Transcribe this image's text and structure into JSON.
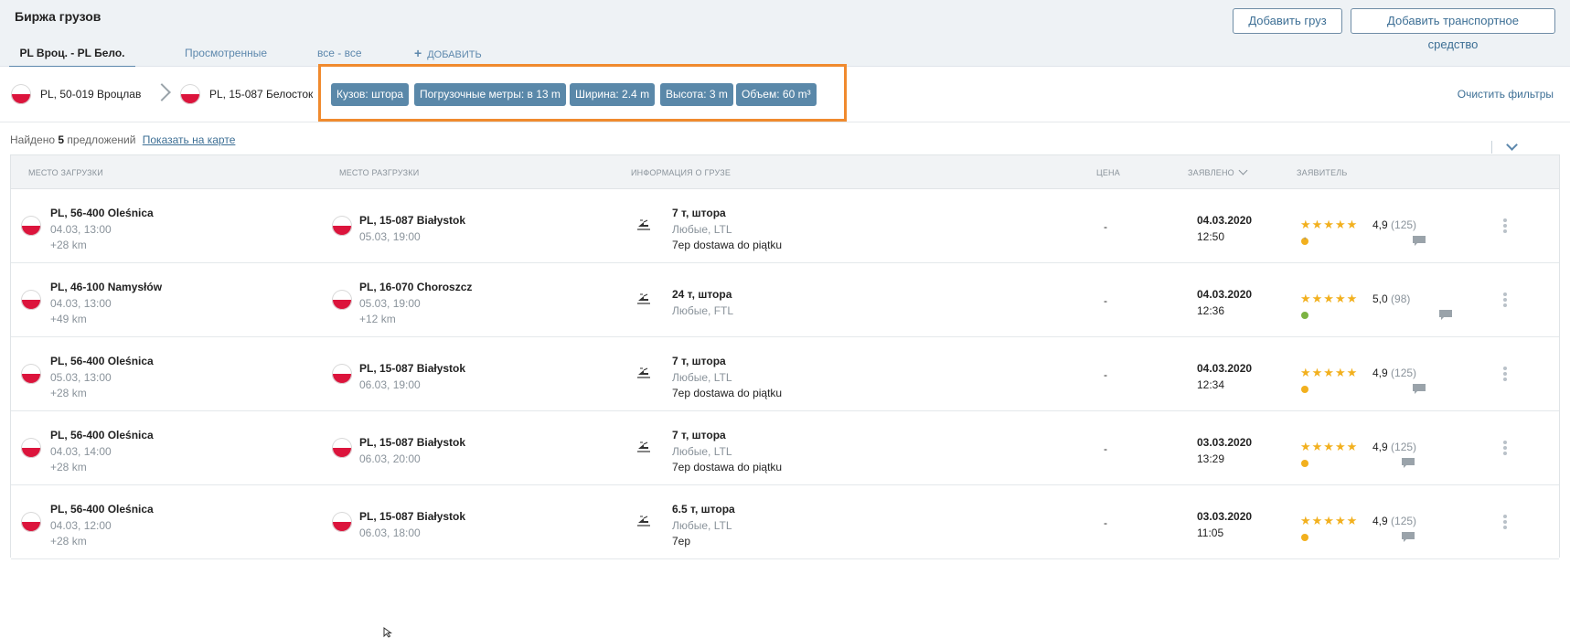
{
  "header": {
    "title": "Биржа грузов",
    "add_cargo": "Добавить груз",
    "add_vehicle": "Добавить транспортное средство"
  },
  "tabs": [
    {
      "label": "PL Вроц. - PL Бело."
    },
    {
      "label": "Просмотренные"
    },
    {
      "label": "все - все"
    },
    {
      "label": "ДОБАВИТЬ",
      "icon": "plus"
    }
  ],
  "filters": {
    "origin": "PL, 50-019 Вроцлав",
    "destination": "PL, 15-087 Белосток",
    "chips": [
      "Кузов: штора",
      "Погрузочные метры: в 13 m",
      "Ширина: 2.4 m",
      "Высота: 3 m",
      "Объем: 60 m³"
    ],
    "clear": "Очистить фильтры"
  },
  "results": {
    "prefix": "Найдено",
    "count": "5",
    "suffix": "предложений",
    "map_link": "Показать на карте"
  },
  "columns": {
    "load": "МЕСТО ЗАГРУЗКИ",
    "unload": "МЕСТО РАЗГРУЗКИ",
    "cargo": "ИНФОРМАЦИЯ О ГРУЗЕ",
    "price": "ЦЕНА",
    "declared": "ЗАЯВЛЕНО",
    "company": "ЗАЯВИТЕЛЬ"
  },
  "rows": [
    {
      "load_place": "PL, 56-400 Oleśnica",
      "load_time": "04.03, 13:00",
      "load_dist": "+28 km",
      "unload_place": "PL, 15-087 Białystok",
      "unload_time": "05.03, 19:00",
      "unload_dist": "",
      "cargo_title": "7 т, штора",
      "cargo_type": "Любые, LTL",
      "cargo_note": "7ep dostawa do piątku",
      "price": "-",
      "date": "04.03.2020",
      "time": "12:50",
      "stars": "★★★★★",
      "rating": "4,9",
      "reviews": "(125)",
      "status_color": "#f2b01e",
      "extra": "'"
    },
    {
      "load_place": "PL, 46-100 Namysłów",
      "load_time": "04.03, 13:00",
      "load_dist": "+49 km",
      "unload_place": "PL, 16-070 Choroszcz",
      "unload_time": "05.03, 19:00",
      "unload_dist": "+12 km",
      "cargo_title": "24 т, штора",
      "cargo_type": "Любые, FTL",
      "cargo_note": "",
      "price": "-",
      "date": "04.03.2020",
      "time": "12:36",
      "stars": "★★★★★",
      "rating": "5,0",
      "reviews": "(98)",
      "status_color": "#7cb342",
      "extra": ""
    },
    {
      "load_place": "PL, 56-400 Oleśnica",
      "load_time": "05.03, 13:00",
      "load_dist": "+28 km",
      "unload_place": "PL, 15-087 Białystok",
      "unload_time": "06.03, 19:00",
      "unload_dist": "",
      "cargo_title": "7 т, штора",
      "cargo_type": "Любые, LTL",
      "cargo_note": "7ep dostawa do piątku",
      "price": "-",
      "date": "04.03.2020",
      "time": "12:34",
      "stars": "★★★★★",
      "rating": "4,9",
      "reviews": "(125)",
      "status_color": "#f2b01e",
      "extra": ""
    },
    {
      "load_place": "PL, 56-400 Oleśnica",
      "load_time": "04.03, 14:00",
      "load_dist": "+28 km",
      "unload_place": "PL, 15-087 Białystok",
      "unload_time": "06.03, 20:00",
      "unload_dist": "",
      "cargo_title": "7 т, штора",
      "cargo_type": "Любые, LTL",
      "cargo_note": "7ep dostawa do piątku",
      "price": "-",
      "date": "03.03.2020",
      "time": "13:29",
      "stars": "★★★★★",
      "rating": "4,9",
      "reviews": "(125)",
      "status_color": "#f2b01e",
      "extra": ""
    },
    {
      "load_place": "PL, 56-400 Oleśnica",
      "load_time": "04.03, 12:00",
      "load_dist": "+28 km",
      "unload_place": "PL, 15-087 Białystok",
      "unload_time": "06.03, 18:00",
      "unload_dist": "",
      "cargo_title": "6.5 т, штора",
      "cargo_type": "Любые, LTL",
      "cargo_note": "7ep",
      "price": "-",
      "date": "03.03.2020",
      "time": "11:05",
      "stars": "★★★★★",
      "rating": "4,9",
      "reviews": "(125)",
      "status_color": "#f2b01e",
      "extra": ""
    }
  ],
  "colors": {
    "accent": "#5d88ad",
    "chip_bg": "#5a88a9",
    "highlight": "#f08a2e",
    "star": "#f2b01e"
  }
}
